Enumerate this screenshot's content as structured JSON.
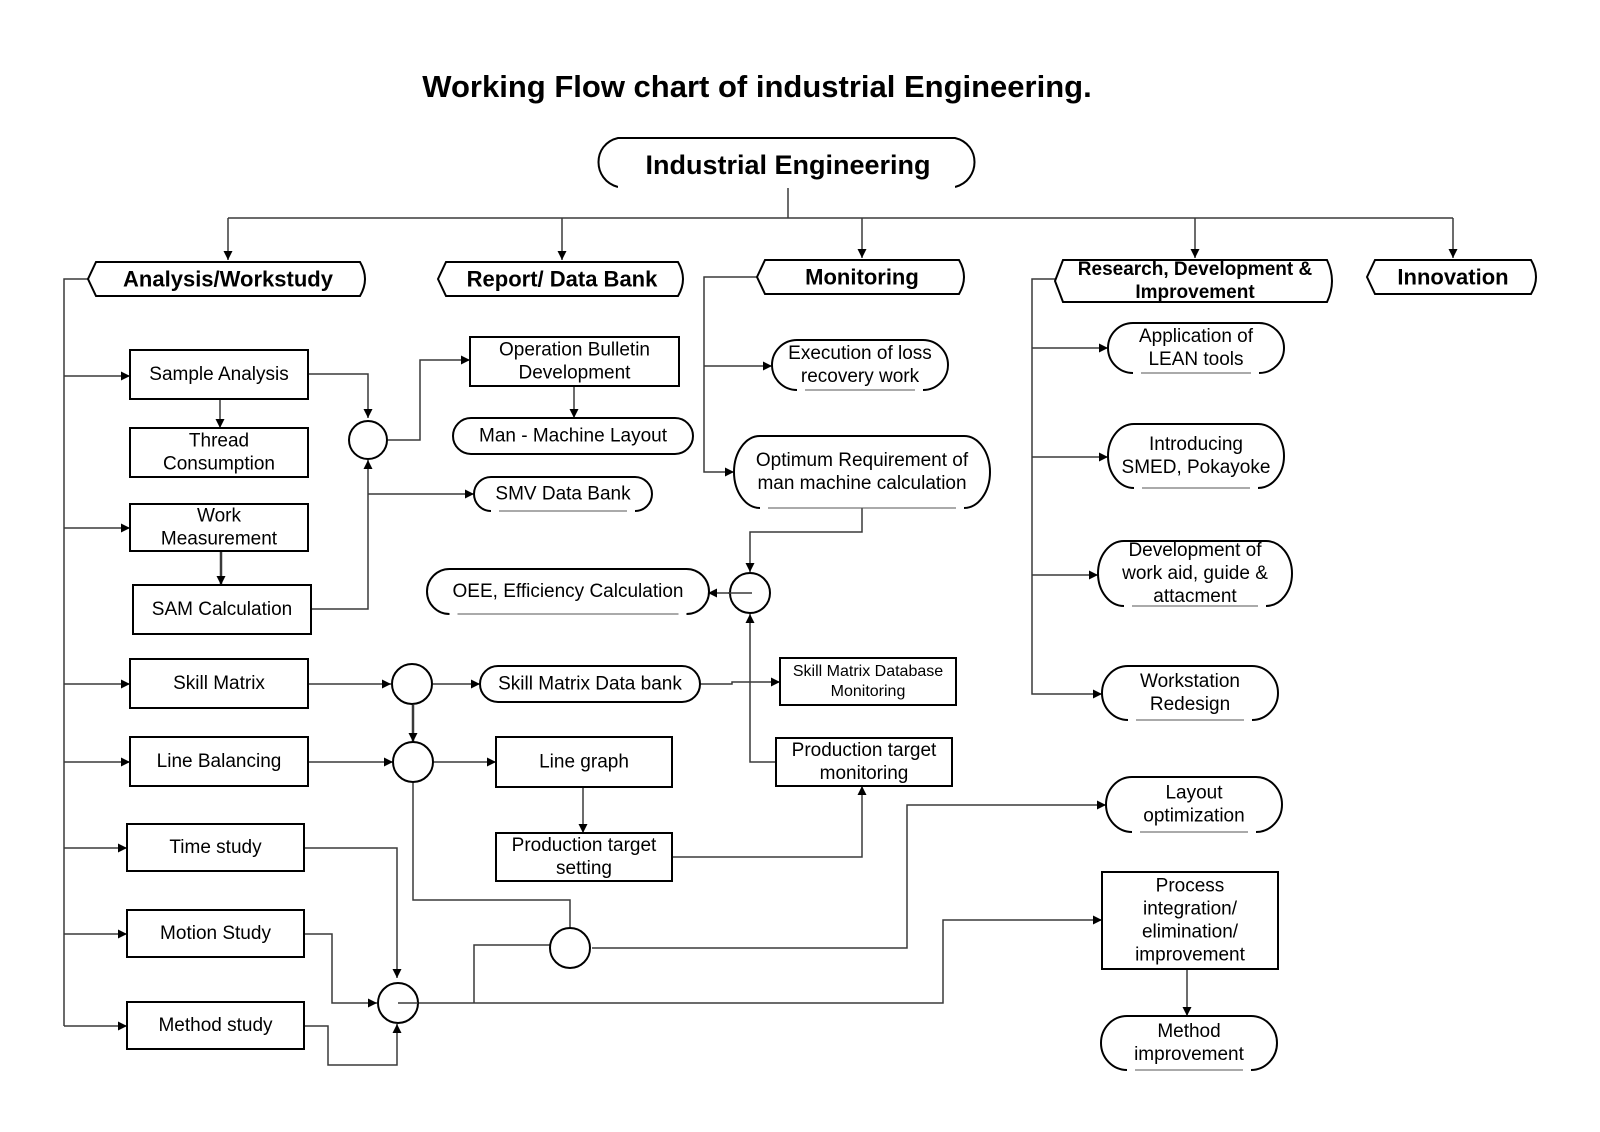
{
  "title": "Working Flow chart of industrial Engineering.",
  "root": {
    "label": "Industrial Engineering"
  },
  "categories": [
    {
      "id": "analysis",
      "label": "Analysis/Workstudy"
    },
    {
      "id": "report",
      "label": "Report/ Data Bank"
    },
    {
      "id": "monitoring",
      "label": "Monitoring"
    },
    {
      "id": "rdi",
      "lines": [
        "Research, Development &",
        "Improvement"
      ]
    },
    {
      "id": "innovation",
      "label": "Innovation"
    }
  ],
  "nodes": {
    "sample_analysis": {
      "lines": [
        "Sample Analysis"
      ]
    },
    "thread_consumption": {
      "lines": [
        "Thread",
        "Consumption"
      ]
    },
    "work_measurement": {
      "lines": [
        "Work",
        "Measurement"
      ]
    },
    "sam_calculation": {
      "lines": [
        "SAM Calculation"
      ]
    },
    "skill_matrix": {
      "lines": [
        "Skill Matrix"
      ]
    },
    "line_balancing": {
      "lines": [
        "Line Balancing"
      ]
    },
    "time_study": {
      "lines": [
        "Time study"
      ]
    },
    "motion_study": {
      "lines": [
        "Motion Study"
      ]
    },
    "method_study": {
      "lines": [
        "Method study"
      ]
    },
    "operation_bulletin": {
      "lines": [
        "Operation Bulletin",
        "Development"
      ]
    },
    "man_machine_layout": {
      "lines": [
        "Man - Machine Layout"
      ]
    },
    "smv_data_bank": {
      "lines": [
        "SMV Data Bank"
      ]
    },
    "oee_efficiency": {
      "lines": [
        "OEE, Efficiency Calculation"
      ]
    },
    "skill_matrix_data_bank": {
      "lines": [
        "Skill Matrix Data bank"
      ]
    },
    "line_graph": {
      "lines": [
        "Line graph"
      ]
    },
    "production_target_setting": {
      "lines": [
        "Production target",
        "setting"
      ]
    },
    "loss_recovery": {
      "lines": [
        "Execution of loss",
        "recovery work"
      ]
    },
    "optimum_requirement": {
      "lines": [
        "Optimum Requirement of",
        "man machine calculation"
      ]
    },
    "skill_matrix_db_monitoring": {
      "lines": [
        "Skill Matrix Database",
        "Monitoring"
      ]
    },
    "production_target_monitoring": {
      "lines": [
        "Production target",
        "monitoring"
      ]
    },
    "lean_tools": {
      "lines": [
        "Application of",
        "LEAN tools"
      ]
    },
    "smed_pokayoke": {
      "lines": [
        "Introducing",
        "SMED, Pokayoke"
      ]
    },
    "work_aid": {
      "lines": [
        "Development of",
        "work aid, guide &",
        "attacment"
      ]
    },
    "workstation_redesign": {
      "lines": [
        "Workstation",
        "Redesign"
      ]
    },
    "layout_optimization": {
      "lines": [
        "Layout",
        "optimization"
      ]
    },
    "process_integration": {
      "lines": [
        "Process",
        "integration/",
        "elimination/",
        "improvement"
      ]
    },
    "method_improvement": {
      "lines": [
        "Method",
        "improvement"
      ]
    }
  }
}
